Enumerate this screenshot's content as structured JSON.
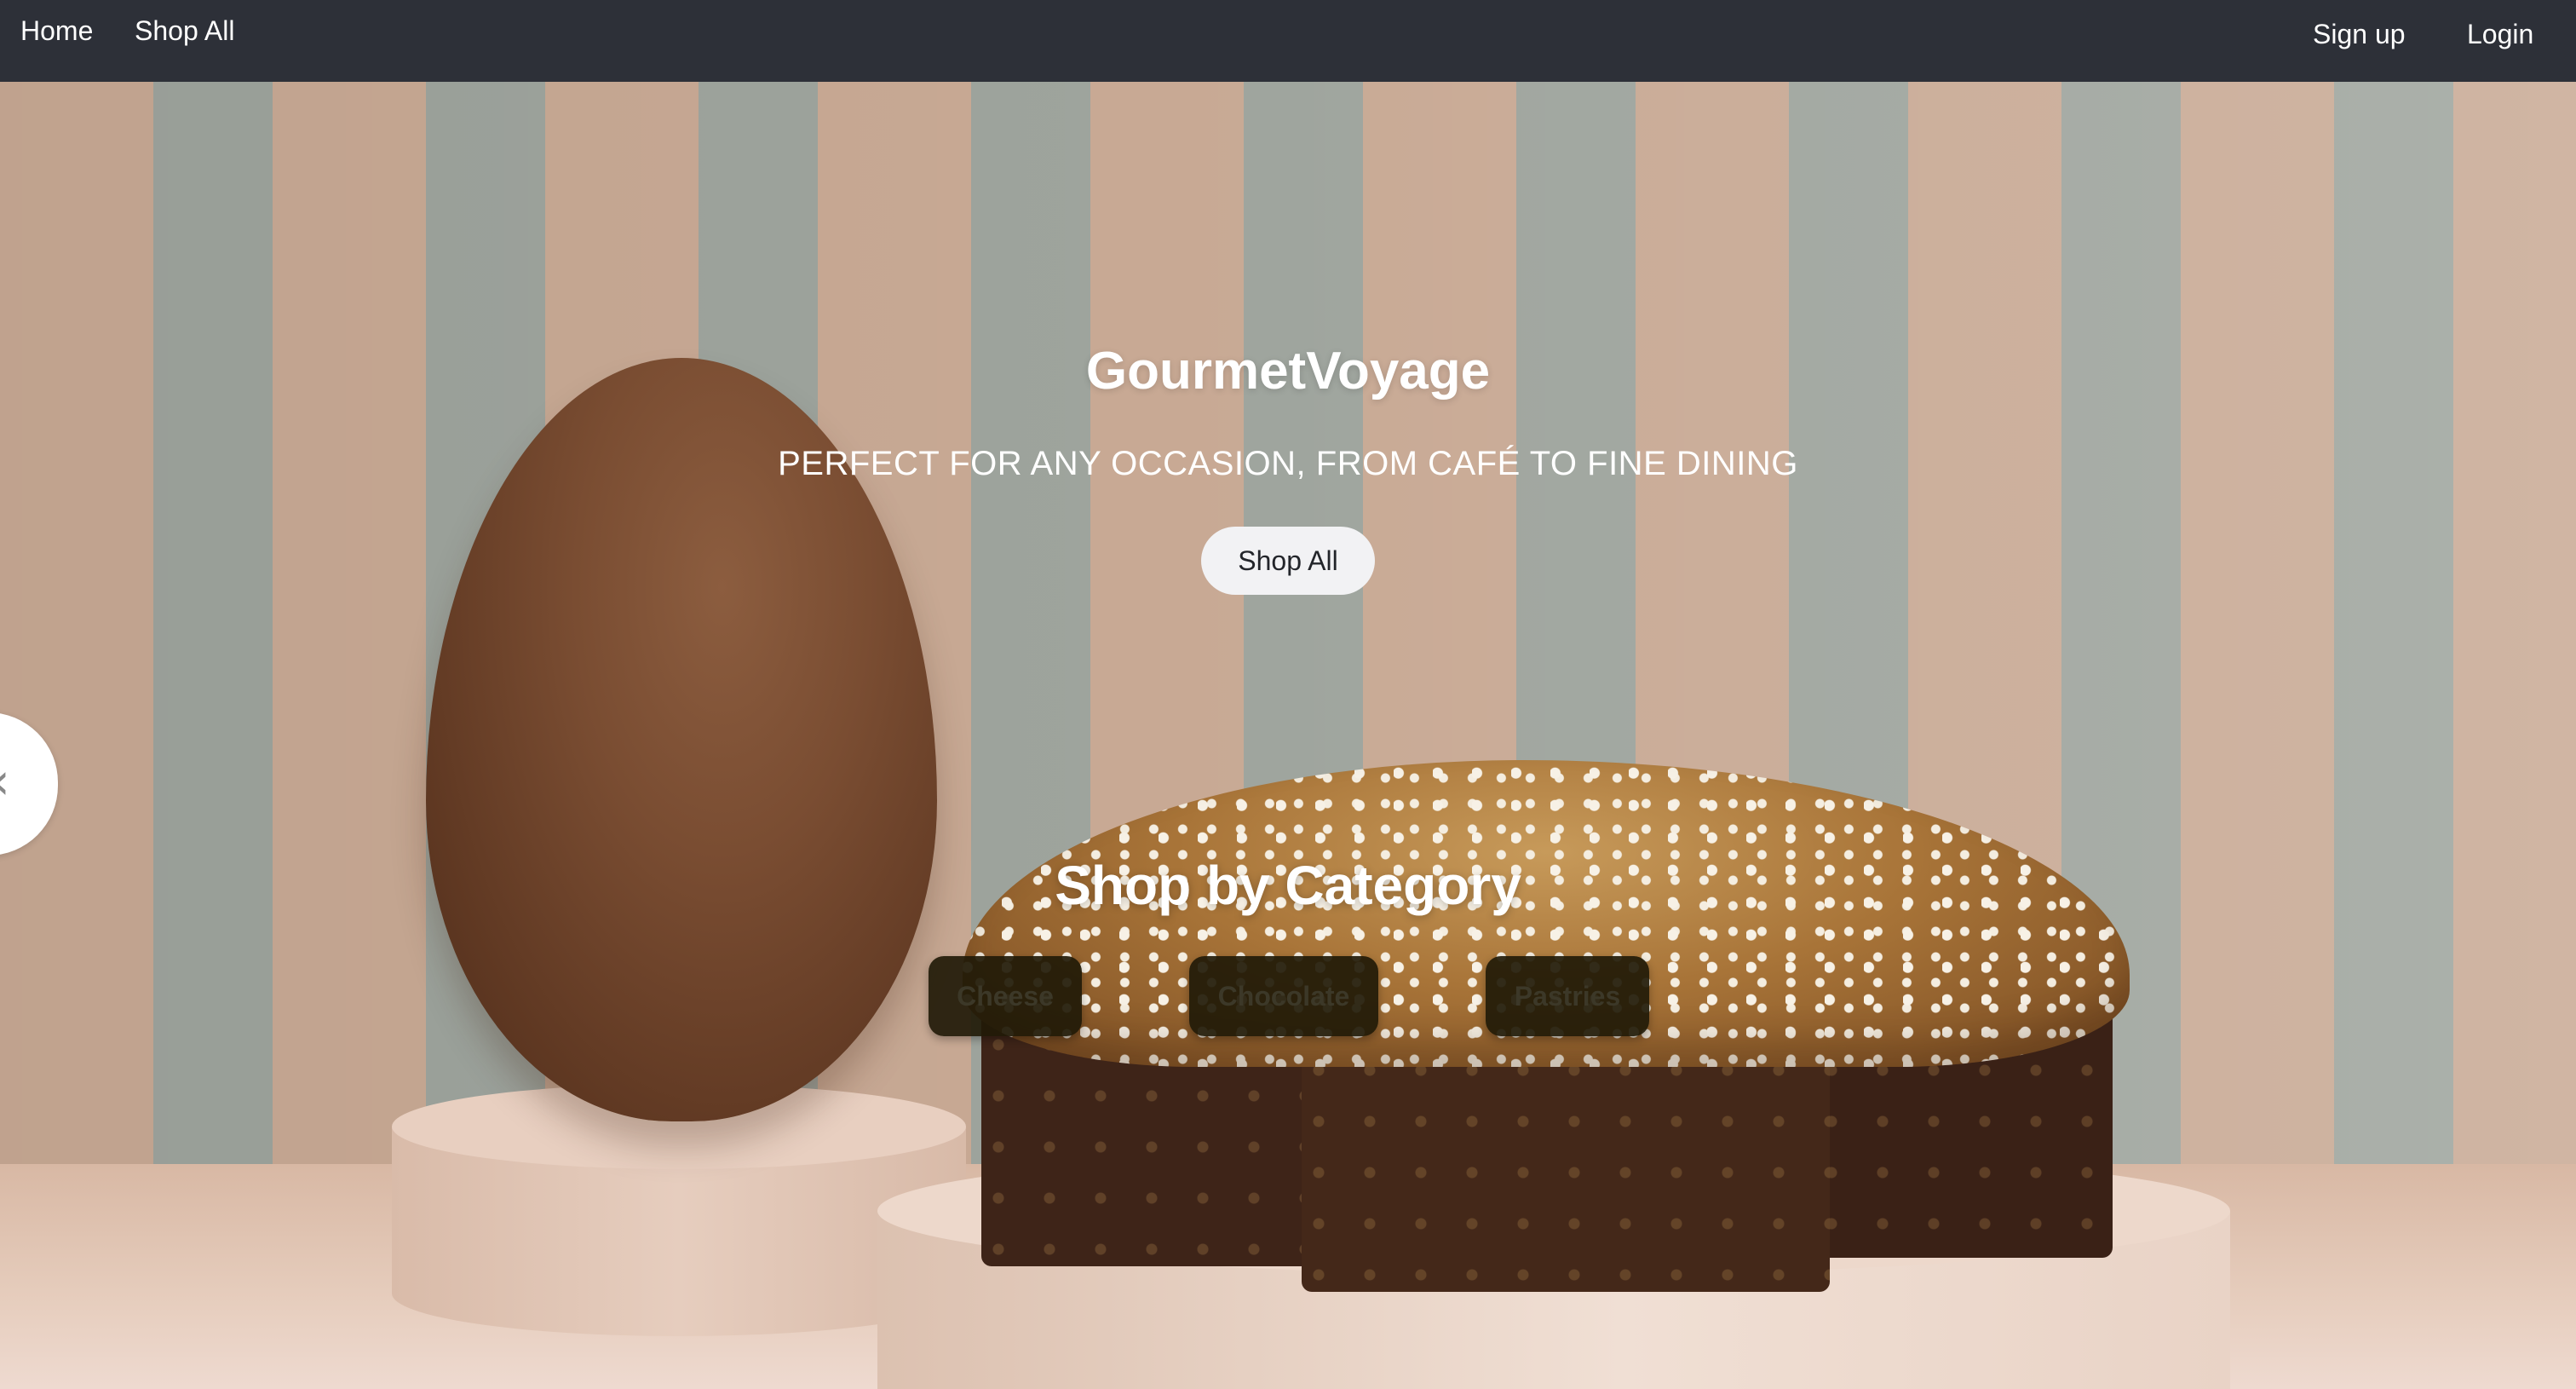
{
  "nav": {
    "home": "Home",
    "shop_all": "Shop All",
    "sign_up": "Sign up",
    "login": "Login"
  },
  "hero": {
    "title": "GourmetVoyage",
    "subtitle": "PERFECT FOR ANY OCCASION, FROM CAFÉ TO FINE DINING",
    "cta": "Shop All",
    "prev_icon": "‹"
  },
  "categories": {
    "title": "Shop by Category",
    "items": [
      {
        "label": "Cheese"
      },
      {
        "label": "Chocolate"
      },
      {
        "label": "Pastries"
      }
    ]
  },
  "colors": {
    "navbar": "#2d3038",
    "accent_button": "#f2f2f4",
    "category_button": "#211a08"
  },
  "icons": {
    "carousel_prev": "chevron-left-icon"
  }
}
